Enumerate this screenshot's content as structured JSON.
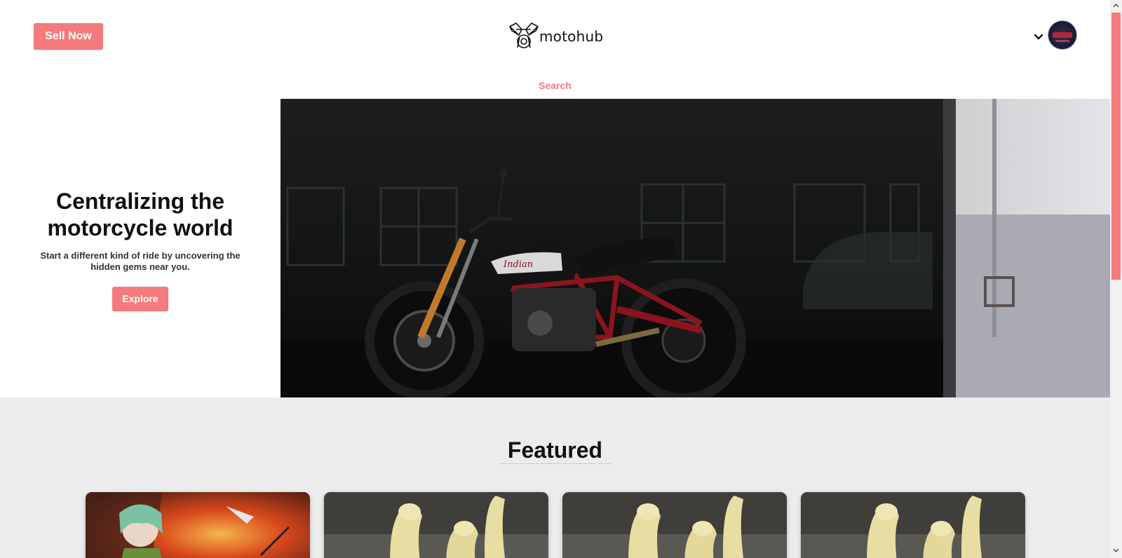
{
  "header": {
    "sell_button": "Sell Now",
    "brand": "motohub",
    "logo_icon": "engine-pistons-icon",
    "user_menu_icon": "chevron-down-icon",
    "avatar_icon": "user-avatar"
  },
  "nav": {
    "search_label": "Search"
  },
  "hero": {
    "title": "Centralizing the motorcycle world",
    "subtitle": "Start a different kind of ride by uncovering the hidden gems near you.",
    "cta_label": "Explore",
    "image_subject": "motorcycle-photo",
    "bike_brand_text": "Indian"
  },
  "featured": {
    "title": "Featured",
    "cards": [
      {
        "image": "anime-character-image"
      },
      {
        "image": "banana-ducks-image"
      },
      {
        "image": "banana-ducks-image"
      },
      {
        "image": "banana-ducks-image"
      }
    ]
  },
  "colors": {
    "accent": "#f47a7c",
    "featured_bg": "#ececec",
    "text": "#111111"
  }
}
